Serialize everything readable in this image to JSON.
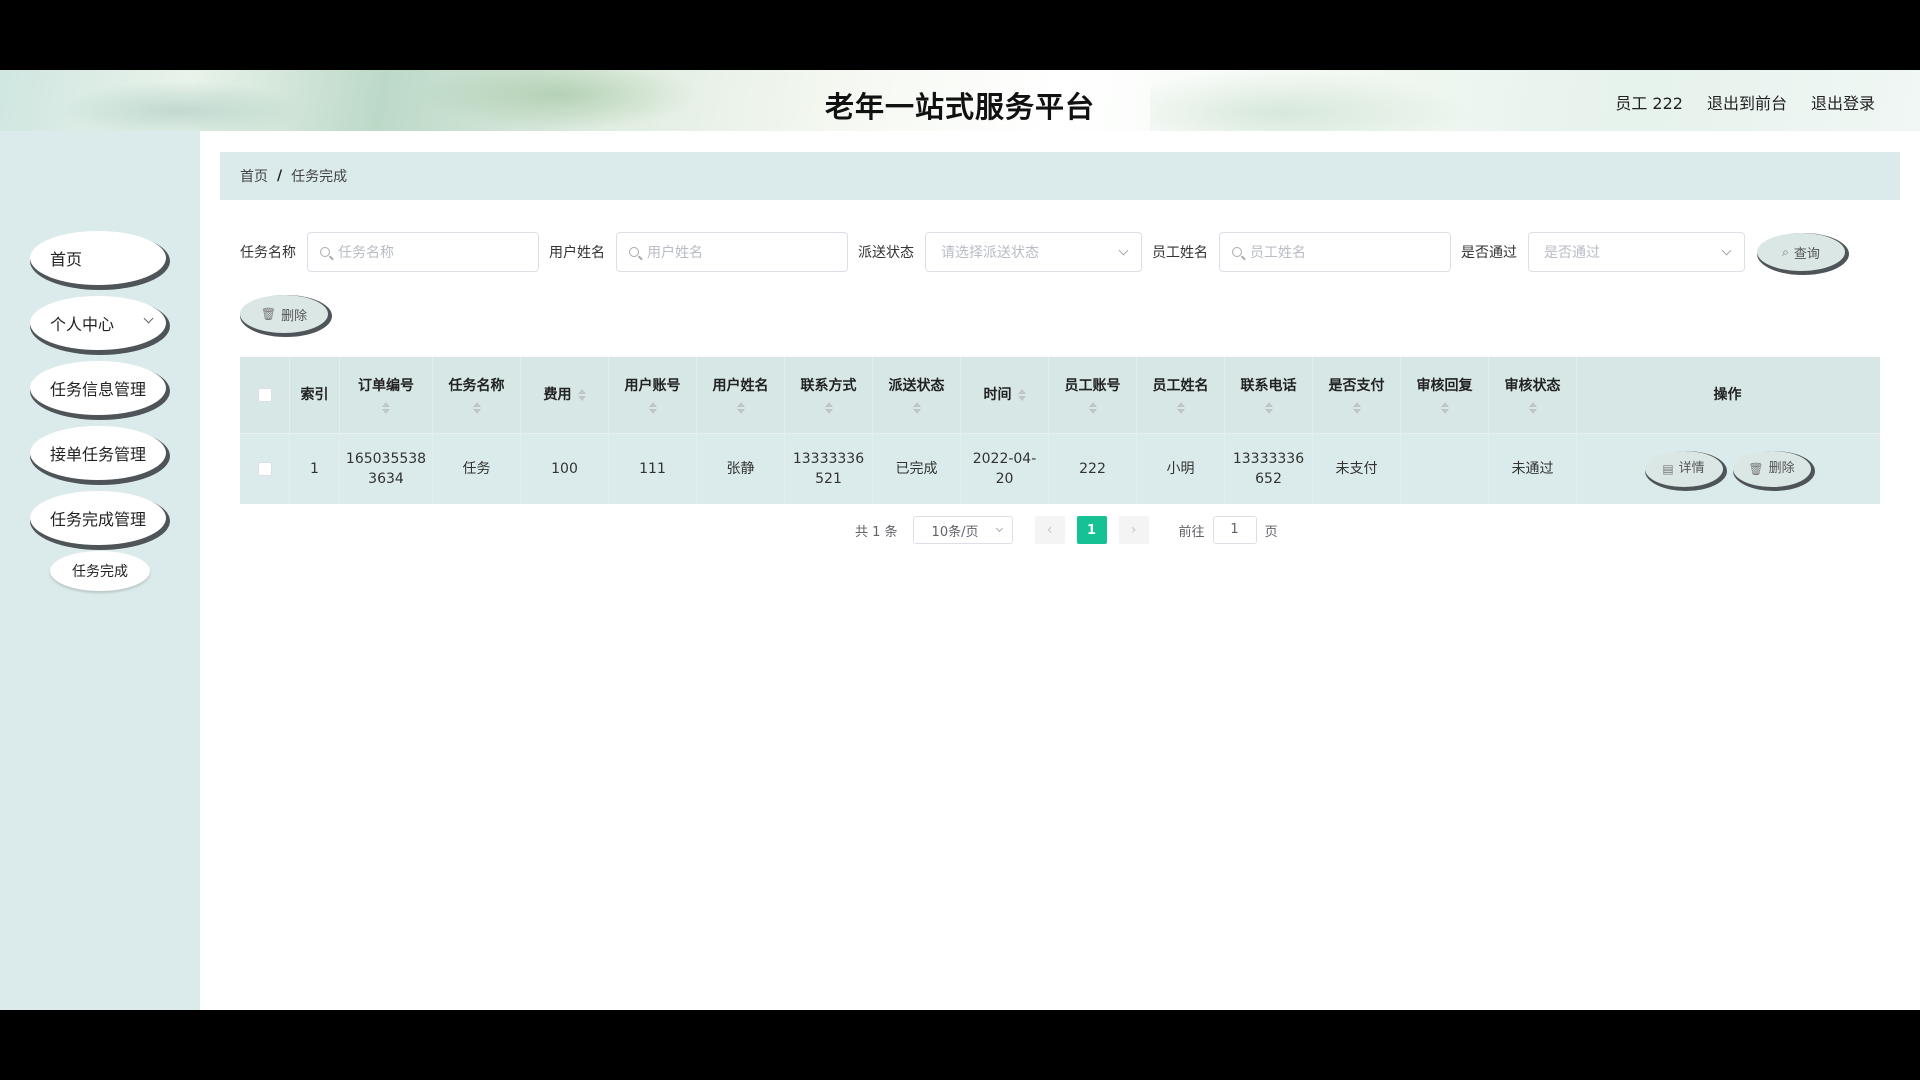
{
  "header": {
    "title": "老年一站式服务平台",
    "user": "员工 222",
    "exit_front": "退出到前台",
    "logout": "退出登录"
  },
  "sidebar": {
    "items": [
      {
        "label": "首页"
      },
      {
        "label": "个人中心"
      },
      {
        "label": "任务信息管理"
      },
      {
        "label": "接单任务管理"
      },
      {
        "label": "任务完成管理"
      }
    ],
    "sub_item": "任务完成"
  },
  "breadcrumb": {
    "home": "首页",
    "sep": "/",
    "current": "任务完成"
  },
  "filters": {
    "task_name_label": "任务名称",
    "task_name_placeholder": "任务名称",
    "user_name_label": "用户姓名",
    "user_name_placeholder": "用户姓名",
    "dispatch_label": "派送状态",
    "dispatch_placeholder": "请选择派送状态",
    "staff_name_label": "员工姓名",
    "staff_name_placeholder": "员工姓名",
    "passed_label": "是否通过",
    "passed_placeholder": "是否通过",
    "search_button": "查询"
  },
  "toolbar": {
    "delete_button": "删除"
  },
  "table": {
    "headers": {
      "index": "索引",
      "order_no": "订单编号",
      "task_name": "任务名称",
      "fee": "费用",
      "user_account": "用户账号",
      "user_name": "用户姓名",
      "contact": "联系方式",
      "dispatch": "派送状态",
      "time": "时间",
      "staff_account": "员工账号",
      "staff_name": "员工姓名",
      "staff_phone": "联系电话",
      "paid": "是否支付",
      "review_reply": "审核回复",
      "review_status": "审核状态",
      "actions": "操作"
    },
    "rows": [
      {
        "index": "1",
        "order_no_1": "165035538",
        "order_no_2": "3634",
        "task_name": "任务",
        "fee": "100",
        "user_account": "111",
        "user_name": "张静",
        "contact_1": "13333336",
        "contact_2": "521",
        "dispatch": "已完成",
        "time_1": "2022-04-",
        "time_2": "20",
        "staff_account": "222",
        "staff_name": "小明",
        "staff_phone_1": "13333336",
        "staff_phone_2": "652",
        "paid": "未支付",
        "review_reply": "",
        "review_status": "未通过",
        "detail_button": "详情",
        "delete_button": "删除"
      }
    ]
  },
  "pagination": {
    "total": "共 1 条",
    "page_size": "10条/页",
    "prev": "‹",
    "current_page": "1",
    "next": "›",
    "goto_label": "前往",
    "goto_value": "1",
    "goto_suffix": "页"
  },
  "colors": {
    "accent": "#16c193",
    "panel": "#dbeaea",
    "button_shadow": "#4e5458"
  },
  "icons": {
    "search": "search-icon",
    "trash": "trash-icon",
    "document": "document-icon",
    "chevron": "chevron-down-icon"
  }
}
